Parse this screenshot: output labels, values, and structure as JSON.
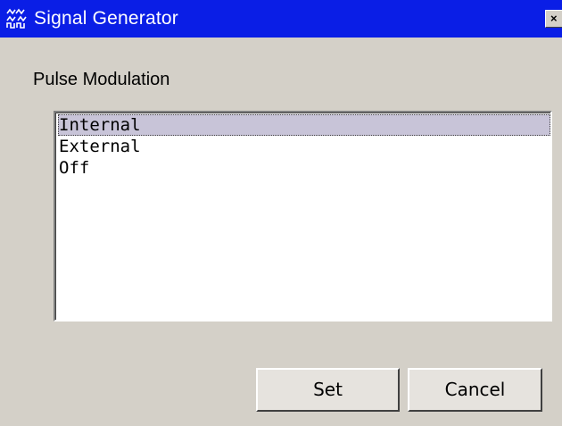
{
  "window": {
    "title": "Signal Generator",
    "title_icon": "signal-generator-icon",
    "close_label": "×"
  },
  "group": {
    "label": "Pulse Modulation"
  },
  "list": {
    "items": [
      {
        "label": "Internal",
        "selected": true
      },
      {
        "label": "External",
        "selected": false
      },
      {
        "label": "Off",
        "selected": false
      }
    ]
  },
  "buttons": {
    "set_label": "Set",
    "cancel_label": "Cancel"
  },
  "colors": {
    "titlebar": "#0a1ee6",
    "dialog_bg": "#d4d0c8",
    "selection": "#c8c4d8"
  }
}
